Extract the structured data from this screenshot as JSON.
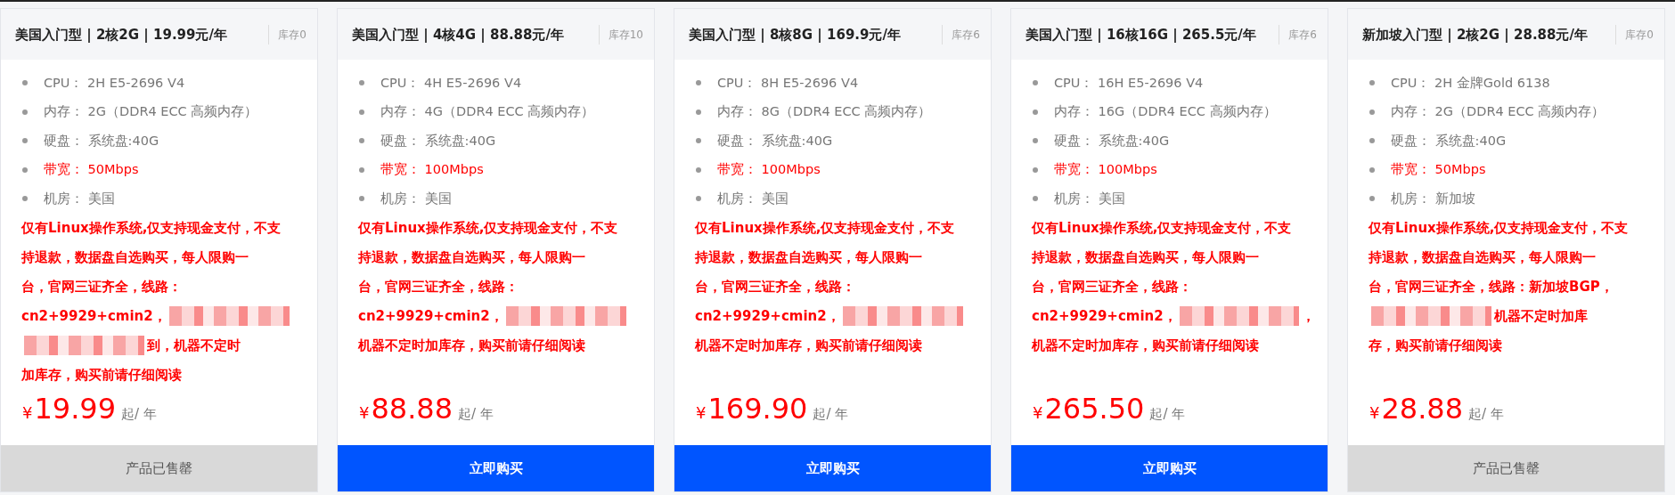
{
  "plans": [
    {
      "title": "美国入门型 | 2核2G | 19.99元/年",
      "stock": "库存0",
      "specs": [
        {
          "label": "CPU：",
          "value": "2H E5-2696 V4",
          "highlight": false
        },
        {
          "label": "内存：",
          "value": "2G（DDR4 ECC 高频内存）",
          "highlight": false
        },
        {
          "label": "硬盘：",
          "value": "系统盘:40G",
          "highlight": false
        },
        {
          "label": "带宽：",
          "value": "50Mbps",
          "highlight": true
        },
        {
          "label": "机房：",
          "value": "美国",
          "highlight": false
        }
      ],
      "note": [
        [
          {
            "kind": "text",
            "text": "仅有Linux操作系统,仅支持现金支付，不支"
          }
        ],
        [
          {
            "kind": "text",
            "text": "持退款，数据盘自选购买，每人限购一"
          }
        ],
        [
          {
            "kind": "text",
            "text": "台，官网三证齐全，线路："
          }
        ],
        [
          {
            "kind": "text",
            "text": "cn2+9929+cmin2，"
          },
          {
            "kind": "redacted"
          }
        ],
        [
          {
            "kind": "redacted"
          },
          {
            "kind": "text",
            "text": "到，机器不定时"
          }
        ],
        [
          {
            "kind": "text",
            "text": "加库存，购买前请仔细阅读"
          }
        ]
      ],
      "currency": "¥",
      "price": "19.99",
      "unit": "起/ 年",
      "button": {
        "label": "产品已售罄",
        "disabled": true
      }
    },
    {
      "title": "美国入门型 | 4核4G | 88.88元/年",
      "stock": "库存10",
      "specs": [
        {
          "label": "CPU：",
          "value": "4H E5-2696 V4",
          "highlight": false
        },
        {
          "label": "内存：",
          "value": "4G（DDR4 ECC 高频内存）",
          "highlight": false
        },
        {
          "label": "硬盘：",
          "value": "系统盘:40G",
          "highlight": false
        },
        {
          "label": "带宽：",
          "value": "100Mbps",
          "highlight": true
        },
        {
          "label": "机房：",
          "value": "美国",
          "highlight": false
        }
      ],
      "note": [
        [
          {
            "kind": "text",
            "text": "仅有Linux操作系统,仅支持现金支付，不支"
          }
        ],
        [
          {
            "kind": "text",
            "text": "持退款，数据盘自选购买，每人限购一"
          }
        ],
        [
          {
            "kind": "text",
            "text": "台，官网三证齐全，线路："
          }
        ],
        [
          {
            "kind": "text",
            "text": "cn2+9929+cmin2，"
          },
          {
            "kind": "redacted"
          }
        ],
        [
          {
            "kind": "text",
            "text": "机器不定时加库存，购买前请仔细阅读"
          }
        ]
      ],
      "currency": "¥",
      "price": "88.88",
      "unit": "起/ 年",
      "button": {
        "label": "立即购买",
        "disabled": false
      }
    },
    {
      "title": "美国入门型 | 8核8G | 169.9元/年",
      "stock": "库存6",
      "specs": [
        {
          "label": "CPU：",
          "value": "8H E5-2696 V4",
          "highlight": false
        },
        {
          "label": "内存：",
          "value": "8G（DDR4 ECC 高频内存）",
          "highlight": false
        },
        {
          "label": "硬盘：",
          "value": "系统盘:40G",
          "highlight": false
        },
        {
          "label": "带宽：",
          "value": "100Mbps",
          "highlight": true
        },
        {
          "label": "机房：",
          "value": "美国",
          "highlight": false
        }
      ],
      "note": [
        [
          {
            "kind": "text",
            "text": "仅有Linux操作系统,仅支持现金支付，不支"
          }
        ],
        [
          {
            "kind": "text",
            "text": "持退款，数据盘自选购买，每人限购一"
          }
        ],
        [
          {
            "kind": "text",
            "text": "台，官网三证齐全，线路："
          }
        ],
        [
          {
            "kind": "text",
            "text": "cn2+9929+cmin2，"
          },
          {
            "kind": "redacted"
          }
        ],
        [
          {
            "kind": "text",
            "text": "机器不定时加库存，购买前请仔细阅读"
          }
        ]
      ],
      "currency": "¥",
      "price": "169.90",
      "unit": "起/ 年",
      "button": {
        "label": "立即购买",
        "disabled": false
      }
    },
    {
      "title": "美国入门型 | 16核16G | 265.5元/年",
      "stock": "库存6",
      "specs": [
        {
          "label": "CPU：",
          "value": "16H E5-2696 V4",
          "highlight": false
        },
        {
          "label": "内存：",
          "value": "16G（DDR4 ECC 高频内存）",
          "highlight": false
        },
        {
          "label": "硬盘：",
          "value": "系统盘:40G",
          "highlight": false
        },
        {
          "label": "带宽：",
          "value": "100Mbps",
          "highlight": true
        },
        {
          "label": "机房：",
          "value": "美国",
          "highlight": false
        }
      ],
      "note": [
        [
          {
            "kind": "text",
            "text": "仅有Linux操作系统,仅支持现金支付，不支"
          }
        ],
        [
          {
            "kind": "text",
            "text": "持退款，数据盘自选购买，每人限购一"
          }
        ],
        [
          {
            "kind": "text",
            "text": "台，官网三证齐全，线路："
          }
        ],
        [
          {
            "kind": "text",
            "text": "cn2+9929+cmin2，"
          },
          {
            "kind": "redacted"
          },
          {
            "kind": "text",
            "text": "，"
          }
        ],
        [
          {
            "kind": "text",
            "text": "机器不定时加库存，购买前请仔细阅读"
          }
        ]
      ],
      "currency": "¥",
      "price": "265.50",
      "unit": "起/ 年",
      "button": {
        "label": "立即购买",
        "disabled": false
      }
    },
    {
      "title": "新加坡入门型 | 2核2G | 28.88元/年",
      "stock": "库存0",
      "specs": [
        {
          "label": "CPU：",
          "value": "2H 金牌Gold 6138",
          "highlight": false
        },
        {
          "label": "内存：",
          "value": "2G（DDR4 ECC 高频内存）",
          "highlight": false
        },
        {
          "label": "硬盘：",
          "value": "系统盘:40G",
          "highlight": false
        },
        {
          "label": "带宽：",
          "value": "50Mbps",
          "highlight": true
        },
        {
          "label": "机房：",
          "value": "新加坡",
          "highlight": false
        }
      ],
      "note": [
        [
          {
            "kind": "text",
            "text": "仅有Linux操作系统,仅支持现金支付，不支"
          }
        ],
        [
          {
            "kind": "text",
            "text": "持退款，数据盘自选购买，每人限购一"
          }
        ],
        [
          {
            "kind": "text",
            "text": "台，官网三证齐全，线路：新加坡BGP，"
          }
        ],
        [
          {
            "kind": "redacted"
          },
          {
            "kind": "text",
            "text": "机器不定时加库"
          }
        ],
        [
          {
            "kind": "text",
            "text": "存，购买前请仔细阅读"
          }
        ]
      ],
      "currency": "¥",
      "price": "28.88",
      "unit": "起/ 年",
      "button": {
        "label": "产品已售罄",
        "disabled": true
      }
    }
  ]
}
